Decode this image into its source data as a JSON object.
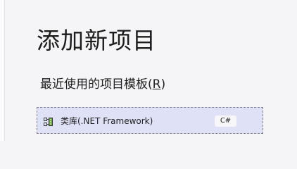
{
  "header": {
    "title": "添加新项目"
  },
  "recent_templates": {
    "heading_prefix": "最近使用的项目模板(",
    "heading_mnemonic": "R",
    "heading_suffix": ")",
    "items": [
      {
        "label": "类库(.NET Framework)",
        "language": "C#",
        "icon": "class-library-icon"
      }
    ]
  },
  "colors": {
    "selected_item_background": "#dfe1f6",
    "selected_item_border": "#7d7f90",
    "page_background": "#f5f5f7"
  }
}
